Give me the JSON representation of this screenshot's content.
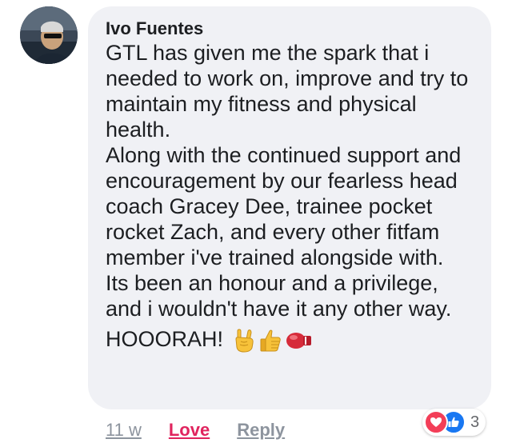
{
  "comment": {
    "author": "Ivo Fuentes",
    "paragraphs": [
      "GTL has given me the spark that i needed to work on, improve and try to maintain my fitness and physical health.",
      "Along with the continued support and encouragement by our fearless head coach Gracey Dee, trainee pocket rocket Zach, and every other fitfam member i've trained alongside with.",
      "Its been an honour and a privilege, and i wouldn't have it any other way."
    ],
    "closing": "HOOORAH!",
    "emojis": [
      "rock-on-hand",
      "thumbs-up",
      "boxing-glove"
    ]
  },
  "actions": {
    "time": "11 w",
    "love": "Love",
    "reply": "Reply"
  },
  "reactions": {
    "icons": [
      "love",
      "like"
    ],
    "count": "3"
  },
  "colors": {
    "bubble": "#f0f1f5",
    "love_accent": "#e0245e",
    "like_blue": "#1877f2",
    "muted": "#8d949e"
  }
}
